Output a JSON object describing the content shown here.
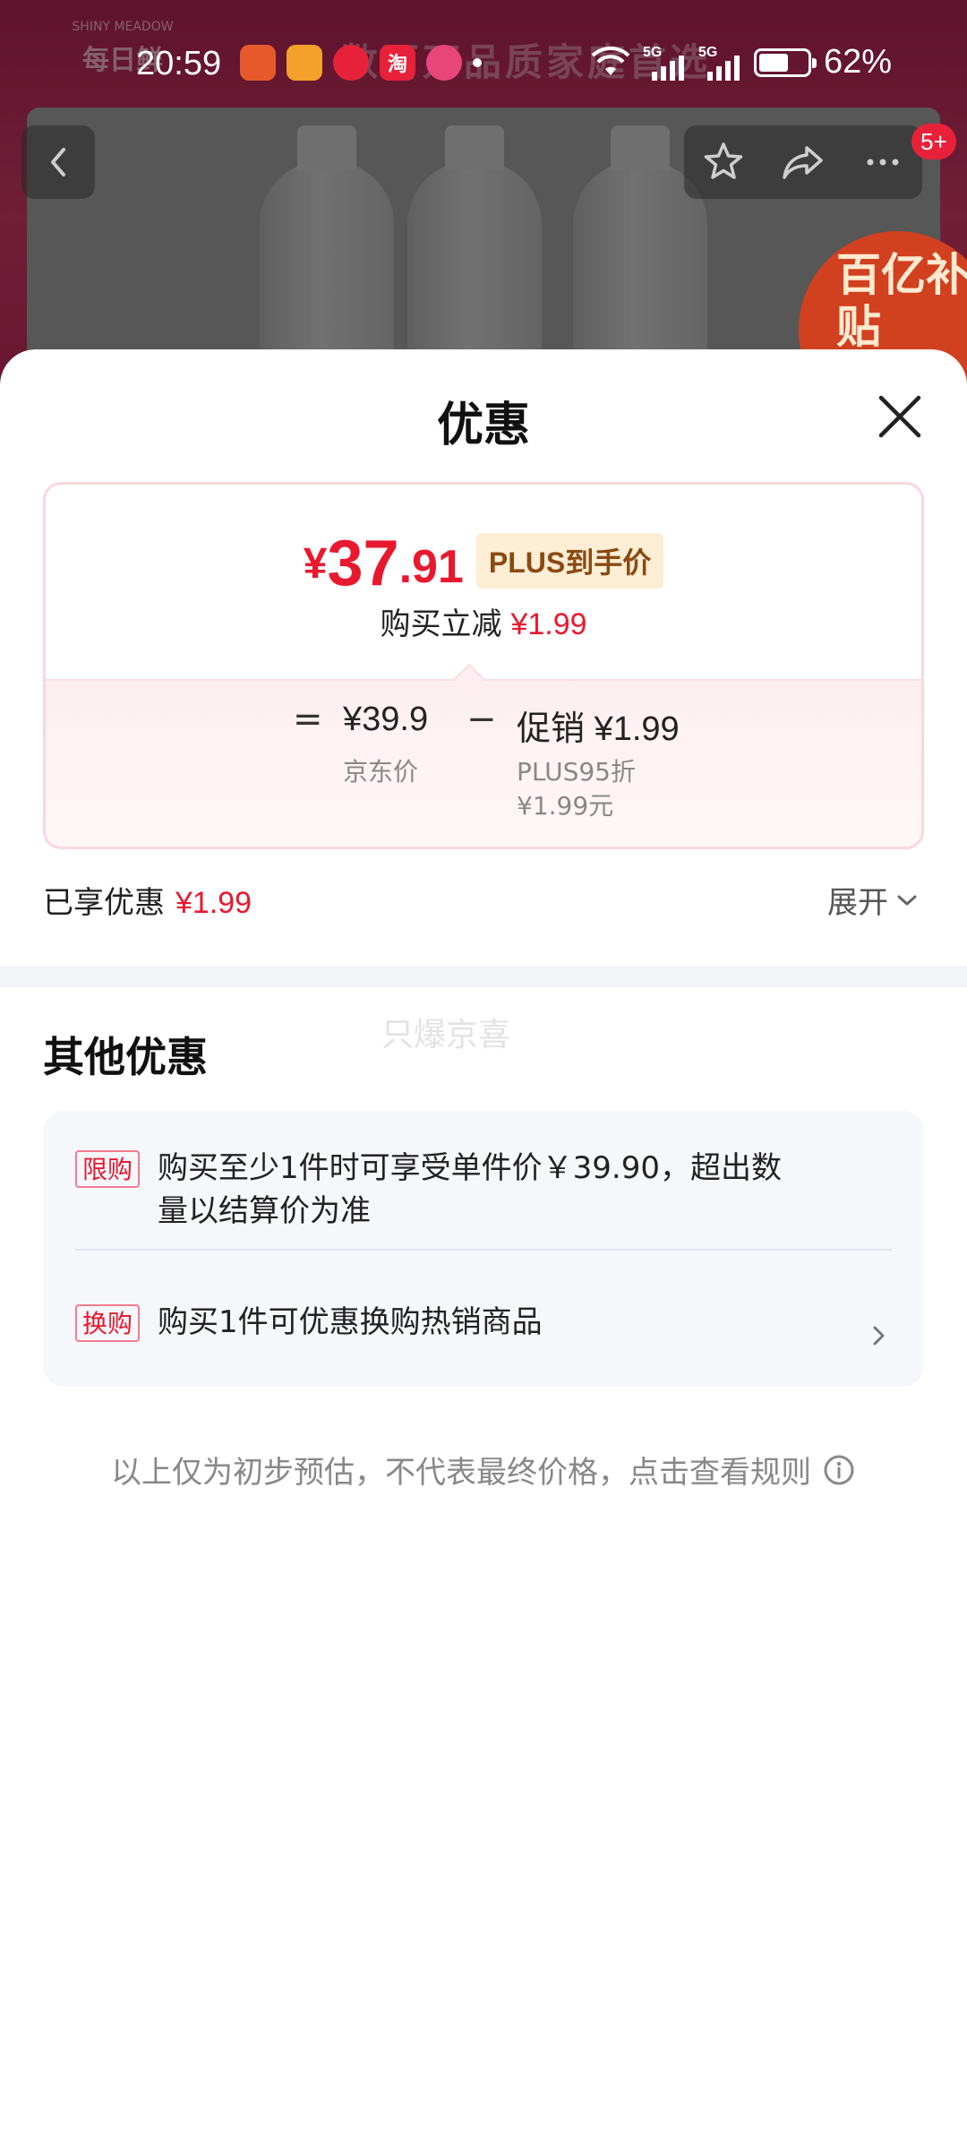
{
  "status_bar": {
    "time": "20:59",
    "battery": "62%",
    "battery_level": 0.62,
    "network_1": "5G",
    "network_2": "5G",
    "apps": [
      {
        "icon": "app-icon-orange",
        "label": "",
        "color": "#e85a2b"
      },
      {
        "icon": "app-icon-video",
        "label": "",
        "color": "#f3a12a"
      },
      {
        "icon": "app-icon-heart",
        "label": "",
        "color": "#e8213a"
      },
      {
        "icon": "app-icon-taobao",
        "label": "淘",
        "color": "#e8213a"
      },
      {
        "icon": "app-icon-pink",
        "label": "",
        "color": "#e8457a"
      }
    ]
  },
  "background": {
    "brand_small": "SHINY MEADOW",
    "brand_big": "每日鲜",
    "banner_text": "数百万品质家庭首选",
    "subsidy_badge": "百亿补贴",
    "notification_count": "5+"
  },
  "sheet": {
    "title": "优惠",
    "final_price": {
      "currency": "¥",
      "integer": "37",
      "decimal": ".91"
    },
    "plus_tag": "PLUS到手价",
    "instant_label": "购买立减",
    "instant_amount": "¥1.99",
    "breakdown": {
      "equals": "=",
      "jd_price": "¥39.9",
      "jd_price_label": "京东价",
      "minus": "−",
      "promo_label": "促销",
      "promo_amount": "¥1.99",
      "promo_detail_1": "PLUS95折",
      "promo_detail_2": "¥1.99元"
    },
    "enjoyed_label": "已享优惠",
    "enjoyed_amount": "¥1.99",
    "expand_label": "展开",
    "other_title": "其他优惠",
    "watermark": "只爆京喜",
    "offers": [
      {
        "tag": "限购",
        "text_line1": "购买至少1件时可享受单件价￥39.90，超出数",
        "text_line2": "量以结算价为准"
      },
      {
        "tag": "换购",
        "text_line1": "购买1件可优惠换购热销商品"
      }
    ],
    "footnote": "以上仅为初步预估，不代表最终价格，点击查看规则"
  },
  "colors": {
    "accent_red": "#e8192f",
    "plus_tag_bg": "#fdeed5",
    "plus_tag_text": "#8a4a12",
    "card_border": "#fbd6de"
  }
}
